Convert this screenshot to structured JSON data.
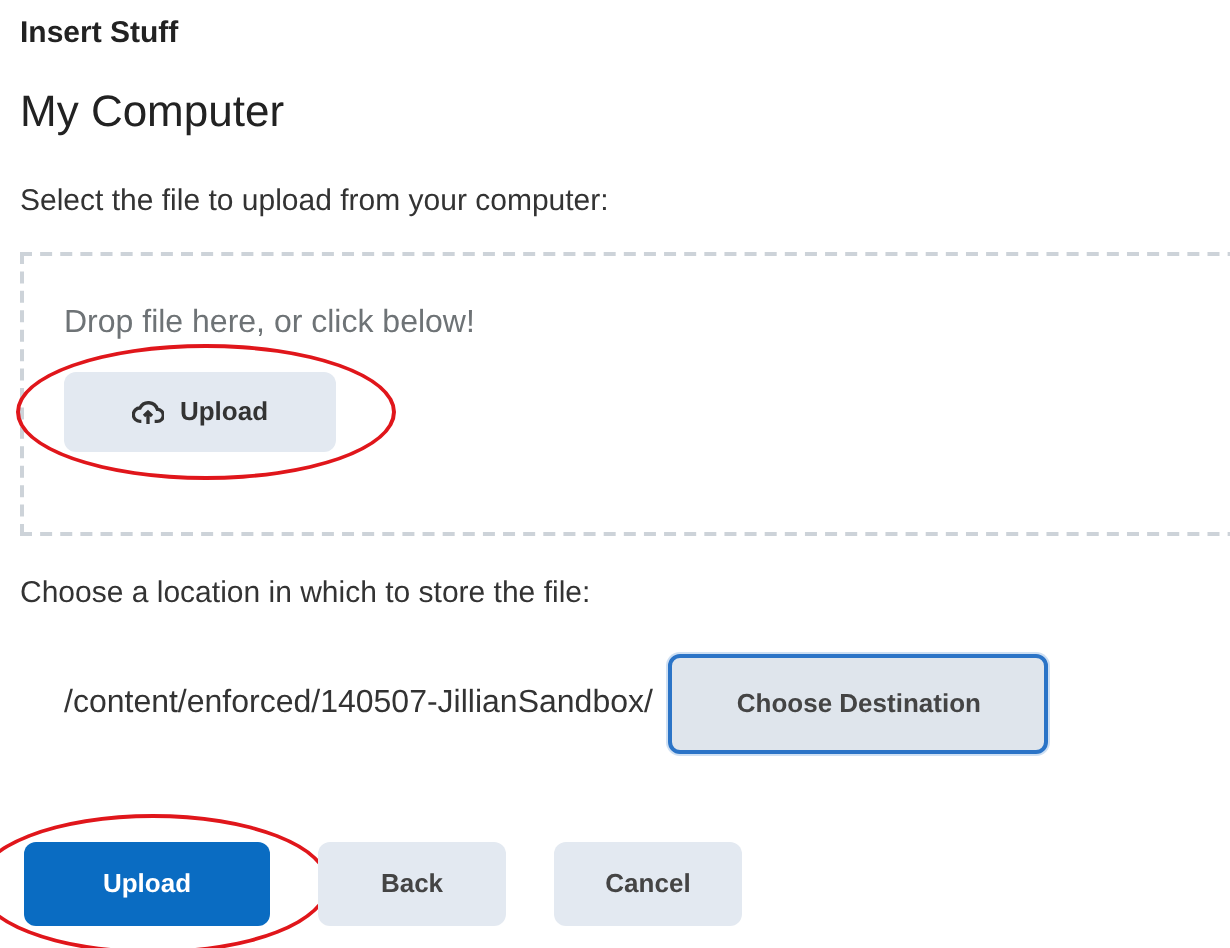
{
  "dialog": {
    "title": "Insert Stuff",
    "heading": "My Computer"
  },
  "file_section": {
    "label": "Select the file to upload from your computer:",
    "drop_hint": "Drop file here, or click below!",
    "upload_button": {
      "label": "Upload",
      "highlighted": true
    }
  },
  "location_section": {
    "label": "Choose a location in which to store the file:",
    "path": "/content/enforced/140507-JillianSandbox/",
    "destination_button": {
      "label": "Choose Destination",
      "focused": true
    }
  },
  "actions": [
    {
      "label": "Upload",
      "kind": "primary",
      "highlighted": true
    },
    {
      "label": "Back",
      "kind": "secondary",
      "highlighted": false
    },
    {
      "label": "Cancel",
      "kind": "secondary",
      "highlighted": false
    }
  ]
}
